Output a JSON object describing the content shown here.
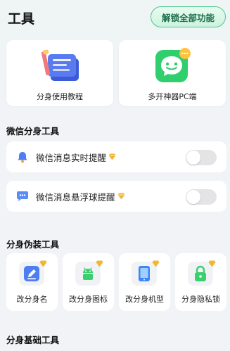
{
  "header": {
    "title": "工具",
    "unlock_label": "解锁全部功能"
  },
  "top_cards": [
    {
      "label": "分身使用教程",
      "icon": "tutorial-book-icon"
    },
    {
      "label": "多开神器PC端",
      "icon": "chat-bubble-icon"
    }
  ],
  "wechat_section": {
    "title": "微信分身工具",
    "rows": [
      {
        "label": "微信消息实时提醒",
        "icon": "bell-icon",
        "toggle": false
      },
      {
        "label": "微信消息悬浮球提醒",
        "icon": "floating-ball-icon",
        "toggle": false
      }
    ]
  },
  "disguise_section": {
    "title": "分身伪装工具",
    "items": [
      {
        "label": "改分身名",
        "icon": "pencil-icon"
      },
      {
        "label": "改分身图标",
        "icon": "android-icon"
      },
      {
        "label": "改分身机型",
        "icon": "phone-icon"
      },
      {
        "label": "分身隐私锁",
        "icon": "lock-icon"
      }
    ]
  },
  "basic_section": {
    "title": "分身基础工具"
  },
  "colors": {
    "accent_green": "#4cc98f",
    "vip_gold": "#f2b635",
    "card_bg": "#ffffff",
    "page_bg": "#f2f3f6"
  }
}
